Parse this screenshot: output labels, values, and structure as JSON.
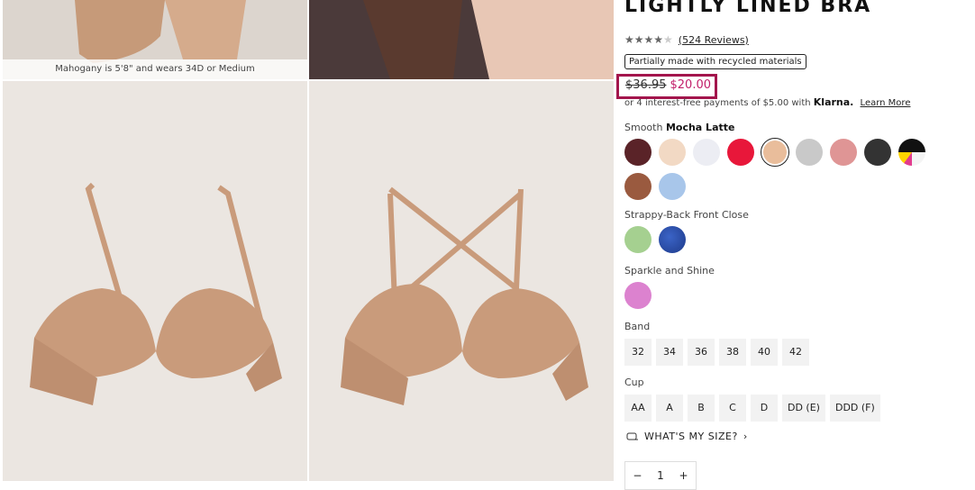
{
  "gallery": {
    "caption": "Mahogany is 5'8\" and wears 34D or Medium"
  },
  "product": {
    "title": "LIGHTLY LINED BRA",
    "rating": {
      "value": 4,
      "max": 5,
      "reviews": "(524 Reviews)"
    },
    "badge": "Partially made with recycled materials",
    "price_old": "$36.95",
    "price_new": "$20.00",
    "klarna_text": "or 4 interest-free payments of $5.00 with",
    "klarna_brand": "Klarna.",
    "klarna_link": "Learn More"
  },
  "colors": {
    "smooth_label": "Smooth",
    "smooth_selected": "Mocha Latte",
    "smooth_swatches": [
      "#5a2328",
      "#f2d9c4",
      "#ecedf3",
      "#e8173a",
      "#e9bd9b",
      "#c9c9c9",
      "#df9595",
      "#333333",
      "pattern",
      "#9a5a3f",
      "#a8c6ea"
    ],
    "strappy_label": "Strappy-Back Front Close",
    "strappy_swatches": [
      "#a5d090",
      "#1e3a8a"
    ],
    "sparkle_label": "Sparkle and Shine",
    "sparkle_swatches": [
      "#dc82cf"
    ]
  },
  "band": {
    "label": "Band",
    "options": [
      "32",
      "34",
      "36",
      "38",
      "40",
      "42"
    ]
  },
  "cup": {
    "label": "Cup",
    "options": [
      "AA",
      "A",
      "B",
      "C",
      "D",
      "DD (E)",
      "DDD (F)"
    ]
  },
  "size_link": "WHAT'S MY SIZE?",
  "quantity": {
    "value": "1",
    "minus": "−",
    "plus": "+"
  }
}
